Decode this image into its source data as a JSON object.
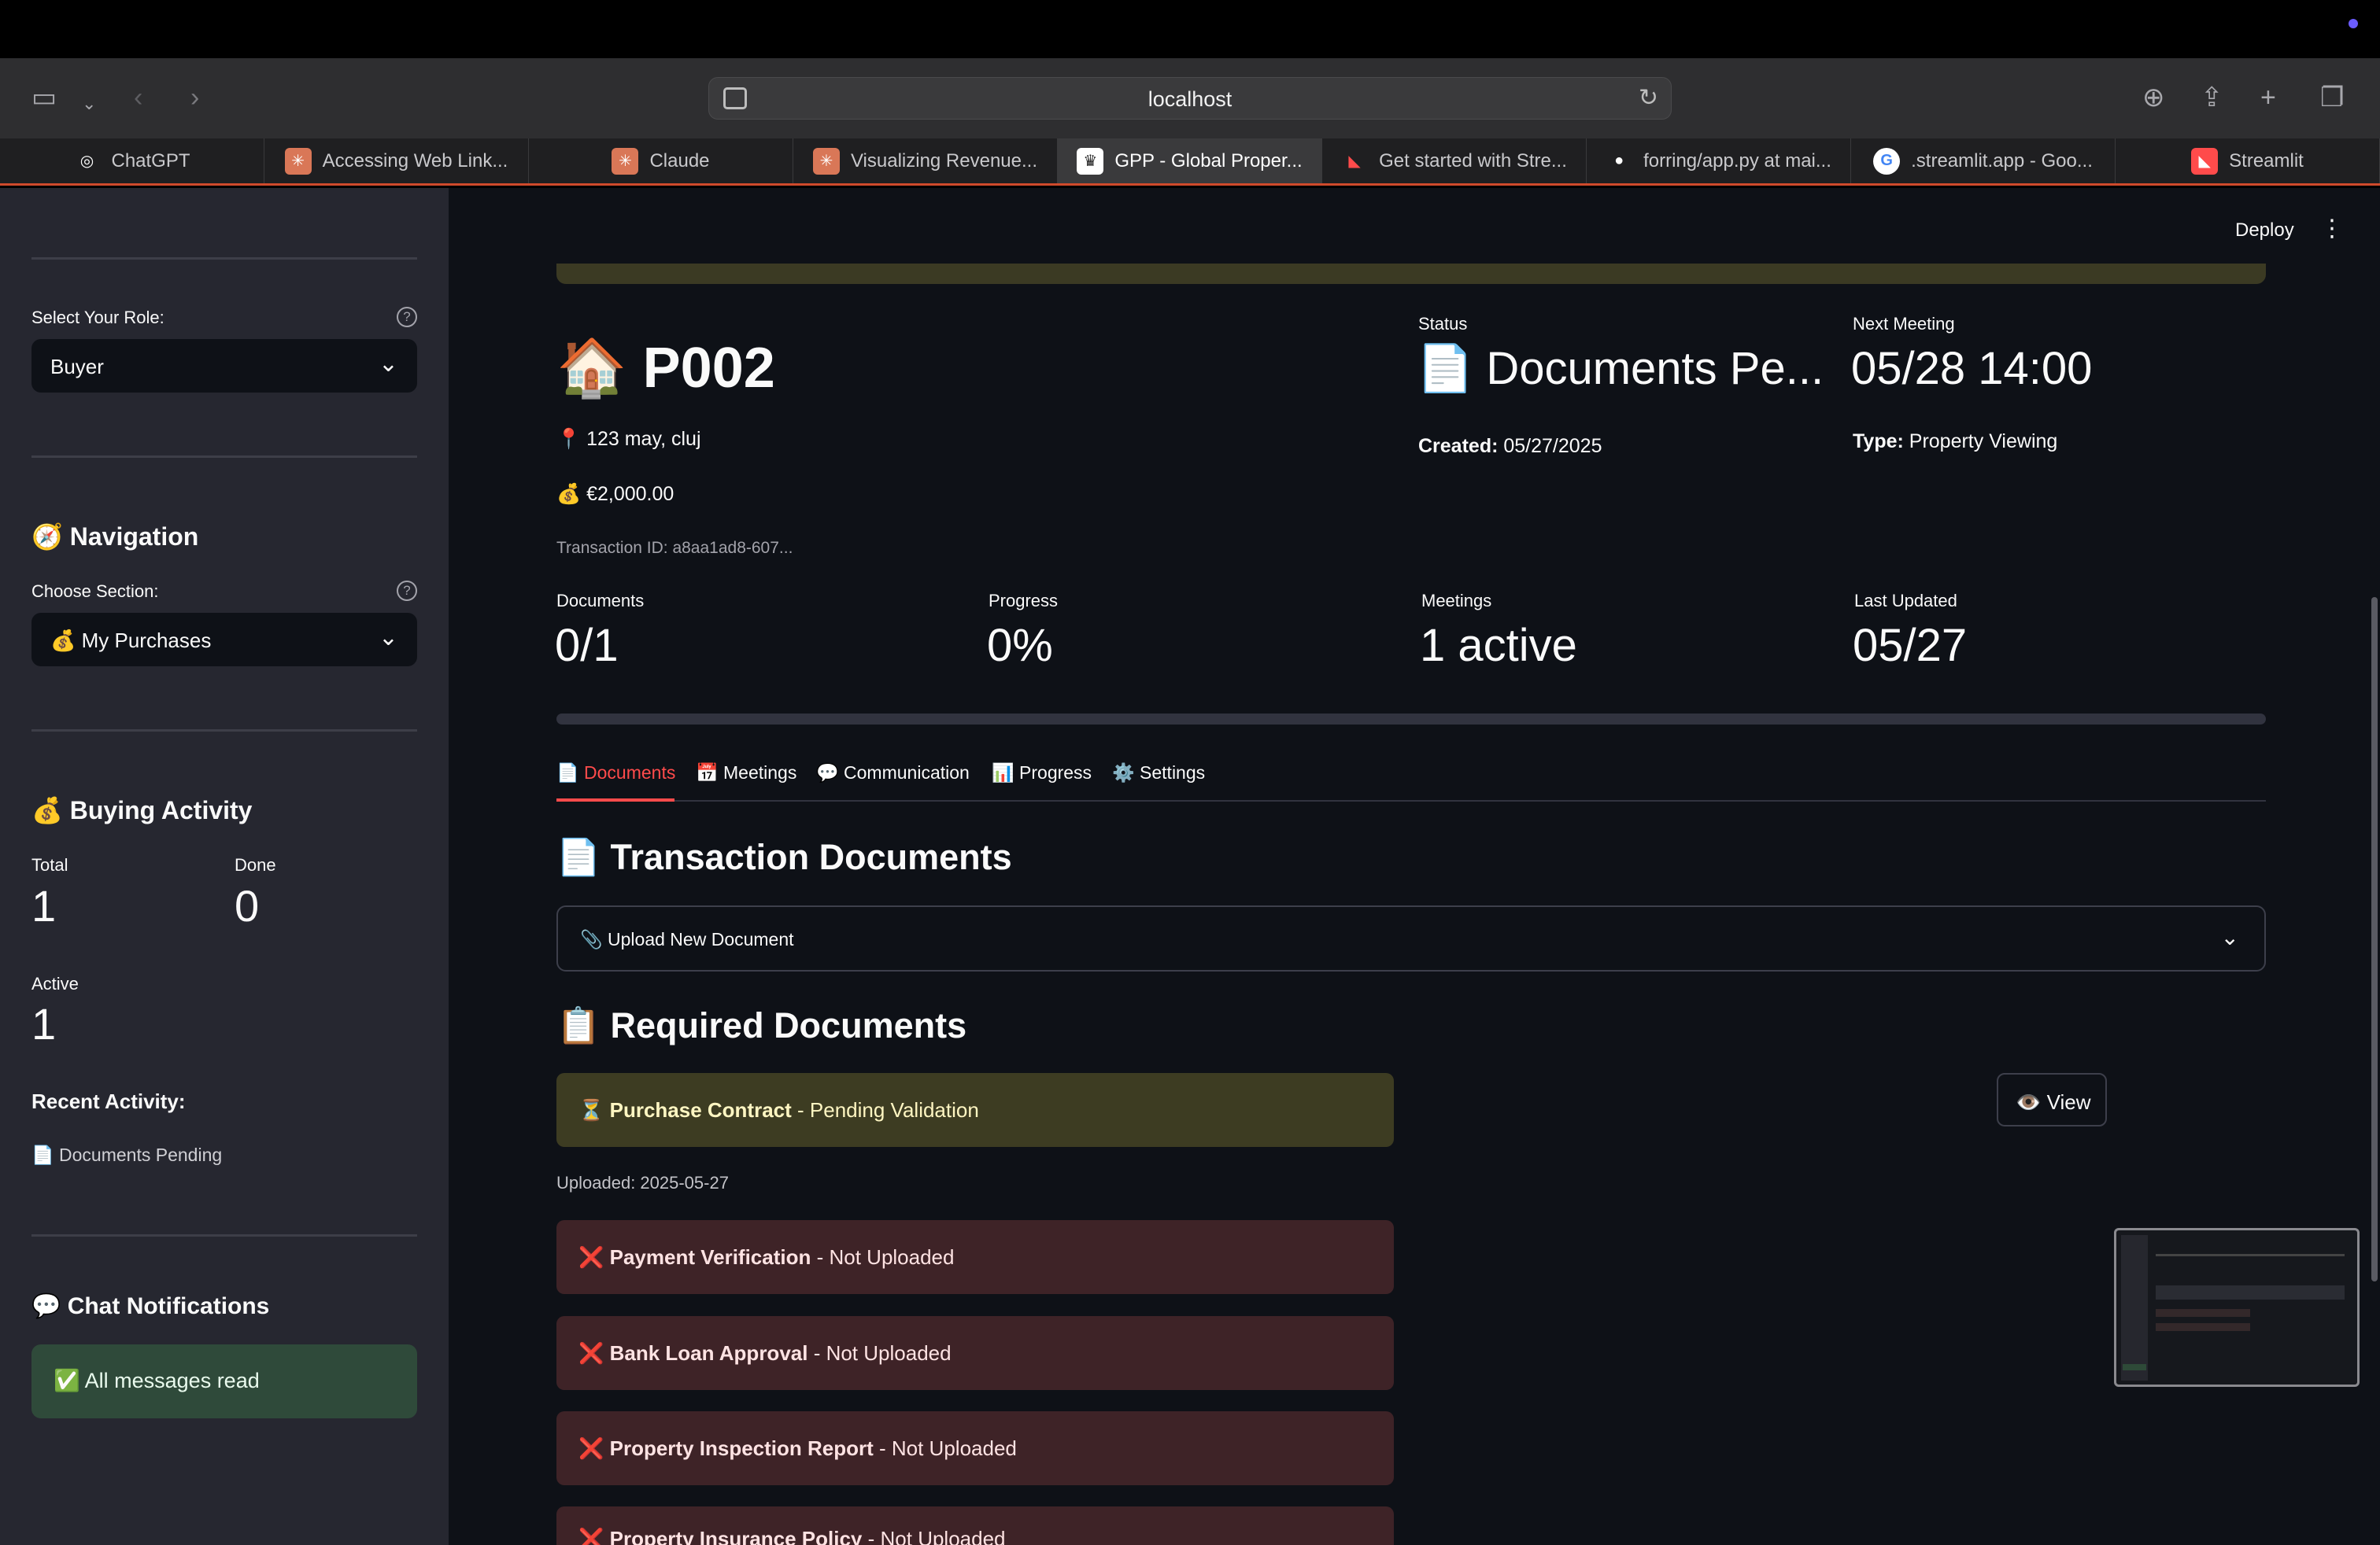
{
  "browser": {
    "url": "localhost",
    "tabs": [
      {
        "label": "ChatGPT",
        "icon": "chatgpt-icon",
        "color": "#3a3a3c",
        "glyph": "◎"
      },
      {
        "label": "Accessing Web Link...",
        "icon": "claude-icon",
        "color": "#d97757",
        "glyph": "✳"
      },
      {
        "label": "Claude",
        "icon": "claude-icon",
        "color": "#d97757",
        "glyph": "✳"
      },
      {
        "label": "Visualizing Revenue...",
        "icon": "claude-icon",
        "color": "#d97757",
        "glyph": "✳"
      },
      {
        "label": "GPP - Global Proper...",
        "icon": "crown-icon",
        "color": "#ffffff",
        "glyph": "♛"
      },
      {
        "label": "Get started with Stre...",
        "icon": "streamlit-icon",
        "color": "#1f1f21",
        "glyph": "◣"
      },
      {
        "label": "forring/app.py at mai...",
        "icon": "github-icon",
        "color": "#1f1f21",
        "glyph": "●"
      },
      {
        "label": ".streamlit.app - Goo...",
        "icon": "google-icon",
        "color": "#ffffff",
        "glyph": "G"
      },
      {
        "label": "Streamlit",
        "icon": "streamlit-icon",
        "color": "#ff4b4b",
        "glyph": "◣"
      }
    ]
  },
  "sidebar": {
    "role_label": "Select Your Role:",
    "role_value": "Buyer",
    "nav_title": "🧭 Navigation",
    "section_label": "Choose Section:",
    "section_value": "💰 My Purchases",
    "activity_title": "💰 Buying Activity",
    "total_label": "Total",
    "total_value": "1",
    "done_label": "Done",
    "done_value": "0",
    "active_label": "Active",
    "active_value": "1",
    "recent_label": "Recent Activity:",
    "recent_item": "📄 Documents Pending",
    "chat_title": "💬 Chat Notifications",
    "chat_status": "✅ All messages read"
  },
  "header": {
    "deploy_label": "Deploy"
  },
  "property": {
    "title": "🏠 P002",
    "address": "📍 123 may, cluj",
    "price": "💰 €2,000.00",
    "transaction_id": "Transaction ID: a8aa1ad8-607...",
    "status_label": "Status",
    "status_value": "📄 Documents Pe...",
    "created_key": "Created:",
    "created_value": " 05/27/2025",
    "meeting_label": "Next Meeting",
    "meeting_value": "05/28 14:00",
    "type_key": "Type:",
    "type_value": " Property Viewing"
  },
  "metrics": {
    "documents_label": "Documents",
    "documents_value": "0/1",
    "progress_label": "Progress",
    "progress_value": "0%",
    "progress_fraction": 0,
    "meetings_label": "Meetings",
    "meetings_value": "1 active",
    "updated_label": "Last Updated",
    "updated_value": "05/27"
  },
  "section_tabs": [
    {
      "label": "📄 Documents",
      "active": true
    },
    {
      "label": "📅 Meetings",
      "active": false
    },
    {
      "label": "💬 Communication",
      "active": false
    },
    {
      "label": "📊 Progress",
      "active": false
    },
    {
      "label": "⚙️ Settings",
      "active": false
    }
  ],
  "documents": {
    "title": "📄 Transaction Documents",
    "upload_label": "📎 Upload New Document",
    "required_title": "📋 Required Documents",
    "items": [
      {
        "icon": "⏳",
        "name": "Purchase Contract",
        "status": " - Pending Validation",
        "state": "pending"
      },
      {
        "icon": "❌",
        "name": "Payment Verification",
        "status": " - Not Uploaded",
        "state": "missing"
      },
      {
        "icon": "❌",
        "name": "Bank Loan Approval",
        "status": " - Not Uploaded",
        "state": "missing"
      },
      {
        "icon": "❌",
        "name": "Property Inspection Report",
        "status": " - Not Uploaded",
        "state": "missing"
      },
      {
        "icon": "❌",
        "name": "Property Insurance Policy",
        "status": " - Not Uploaded",
        "state": "missing"
      }
    ],
    "uploaded_note": "Uploaded: 2025-05-27",
    "view_label": "👁️ View"
  }
}
